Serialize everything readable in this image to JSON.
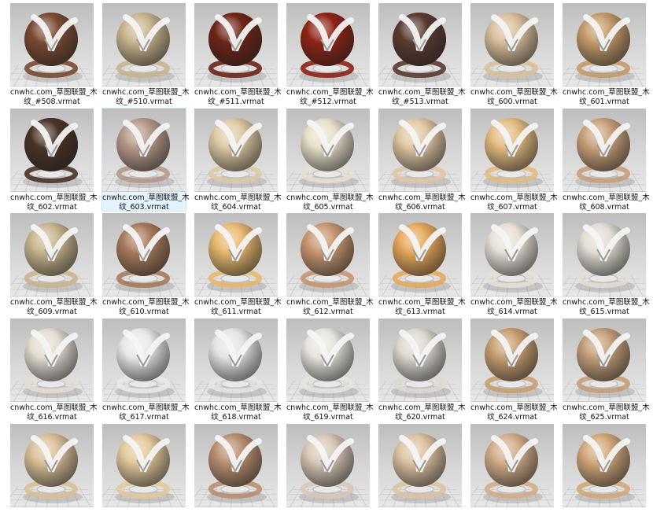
{
  "explorer": {
    "view": "large-icons",
    "items": [
      {
        "line1": "cnwhc.com_草图联盟_木",
        "line2": "纹_#508.vrmat",
        "color": "#7a4a32",
        "selected": false
      },
      {
        "line1": "cnwhc.com_草图联盟_木",
        "line2": "纹_#510.vrmat",
        "color": "#c9b48f",
        "selected": false
      },
      {
        "line1": "cnwhc.com_草图联盟_木",
        "line2": "纹_#511.vrmat",
        "color": "#6d2418",
        "selected": false
      },
      {
        "line1": "cnwhc.com_草图联盟_木",
        "line2": "纹_#512.vrmat",
        "color": "#8e2416",
        "selected": false
      },
      {
        "line1": "cnwhc.com_草图联盟_木",
        "line2": "纹_#513.vrmat",
        "color": "#5a3a30",
        "selected": false
      },
      {
        "line1": "cnwhc.com_草图联盟_木",
        "line2": "纹_600.vrmat",
        "color": "#d9bf9c",
        "selected": false
      },
      {
        "line1": "cnwhc.com_草图联盟_木",
        "line2": "纹_601.vrmat",
        "color": "#c49a6a",
        "selected": false
      },
      {
        "line1": "cnwhc.com_草图联盟_木",
        "line2": "纹_602.vrmat",
        "color": "#4a3328",
        "selected": false
      },
      {
        "line1": "cnwhc.com_草图联盟_木",
        "line2": "纹_603.vrmat",
        "color": "#b6998a",
        "selected": true
      },
      {
        "line1": "cnwhc.com_草图联盟_木",
        "line2": "纹_604.vrmat",
        "color": "#dec9a4",
        "selected": false
      },
      {
        "line1": "cnwhc.com_草图联盟_木",
        "line2": "纹_605.vrmat",
        "color": "#e8e0cc",
        "selected": false
      },
      {
        "line1": "cnwhc.com_草图联盟_木",
        "line2": "纹_606.vrmat",
        "color": "#e0c7a4",
        "selected": false
      },
      {
        "line1": "cnwhc.com_草图联盟_木",
        "line2": "纹_607.vrmat",
        "color": "#e4bb80",
        "selected": false
      },
      {
        "line1": "cnwhc.com_草图联盟_木",
        "line2": "纹_608.vrmat",
        "color": "#c9a07a",
        "selected": false
      },
      {
        "line1": "cnwhc.com_草图联盟_木",
        "line2": "纹_609.vrmat",
        "color": "#c8b48e",
        "selected": false
      },
      {
        "line1": "cnwhc.com_草图联盟_木",
        "line2": "纹_610.vrmat",
        "color": "#a87a5c",
        "selected": false
      },
      {
        "line1": "cnwhc.com_草图联盟_木",
        "line2": "纹_611.vrmat",
        "color": "#e8b86e",
        "selected": false
      },
      {
        "line1": "cnwhc.com_草图联盟_木",
        "line2": "纹_612.vrmat",
        "color": "#c79670",
        "selected": false
      },
      {
        "line1": "cnwhc.com_草图联盟_木",
        "line2": "纹_613.vrmat",
        "color": "#e6a85c",
        "selected": false
      },
      {
        "line1": "cnwhc.com_草图联盟_木",
        "line2": "纹_614.vrmat",
        "color": "#e6e0d6",
        "selected": false
      },
      {
        "line1": "cnwhc.com_草图联盟_木",
        "line2": "纹_615.vrmat",
        "color": "#e2ddd4",
        "selected": false
      },
      {
        "line1": "cnwhc.com_草图联盟_木",
        "line2": "纹_616.vrmat",
        "color": "#e3ddd2",
        "selected": false
      },
      {
        "line1": "cnwhc.com_草图联盟_木",
        "line2": "纹_617.vrmat",
        "color": "#e8e8e6",
        "selected": false
      },
      {
        "line1": "cnwhc.com_草图联盟_木",
        "line2": "纹_618.vrmat",
        "color": "#e4e4e2",
        "selected": false
      },
      {
        "line1": "cnwhc.com_草图联盟_木",
        "line2": "纹_619.vrmat",
        "color": "#e6e4dc",
        "selected": false
      },
      {
        "line1": "cnwhc.com_草图联盟_木",
        "line2": "纹_620.vrmat",
        "color": "#ddd9d0",
        "selected": false
      },
      {
        "line1": "cnwhc.com_草图联盟_木",
        "line2": "纹_624.vrmat",
        "color": "#c89f72",
        "selected": false
      },
      {
        "line1": "cnwhc.com_草图联盟_木",
        "line2": "纹_625.vrmat",
        "color": "#c49e7a",
        "selected": false
      },
      {
        "line1": "",
        "line2": "",
        "color": "#d9bf98",
        "selected": false
      },
      {
        "line1": "",
        "line2": "",
        "color": "#e2c89a",
        "selected": false
      },
      {
        "line1": "",
        "line2": "",
        "color": "#b98e70",
        "selected": false
      },
      {
        "line1": "",
        "line2": "",
        "color": "#d8c8b8",
        "selected": false
      },
      {
        "line1": "",
        "line2": "",
        "color": "#dcc2a2",
        "selected": false
      },
      {
        "line1": "",
        "line2": "",
        "color": "#d3ac88",
        "selected": false
      },
      {
        "line1": "",
        "line2": "",
        "color": "#d2a77a",
        "selected": false
      }
    ]
  }
}
